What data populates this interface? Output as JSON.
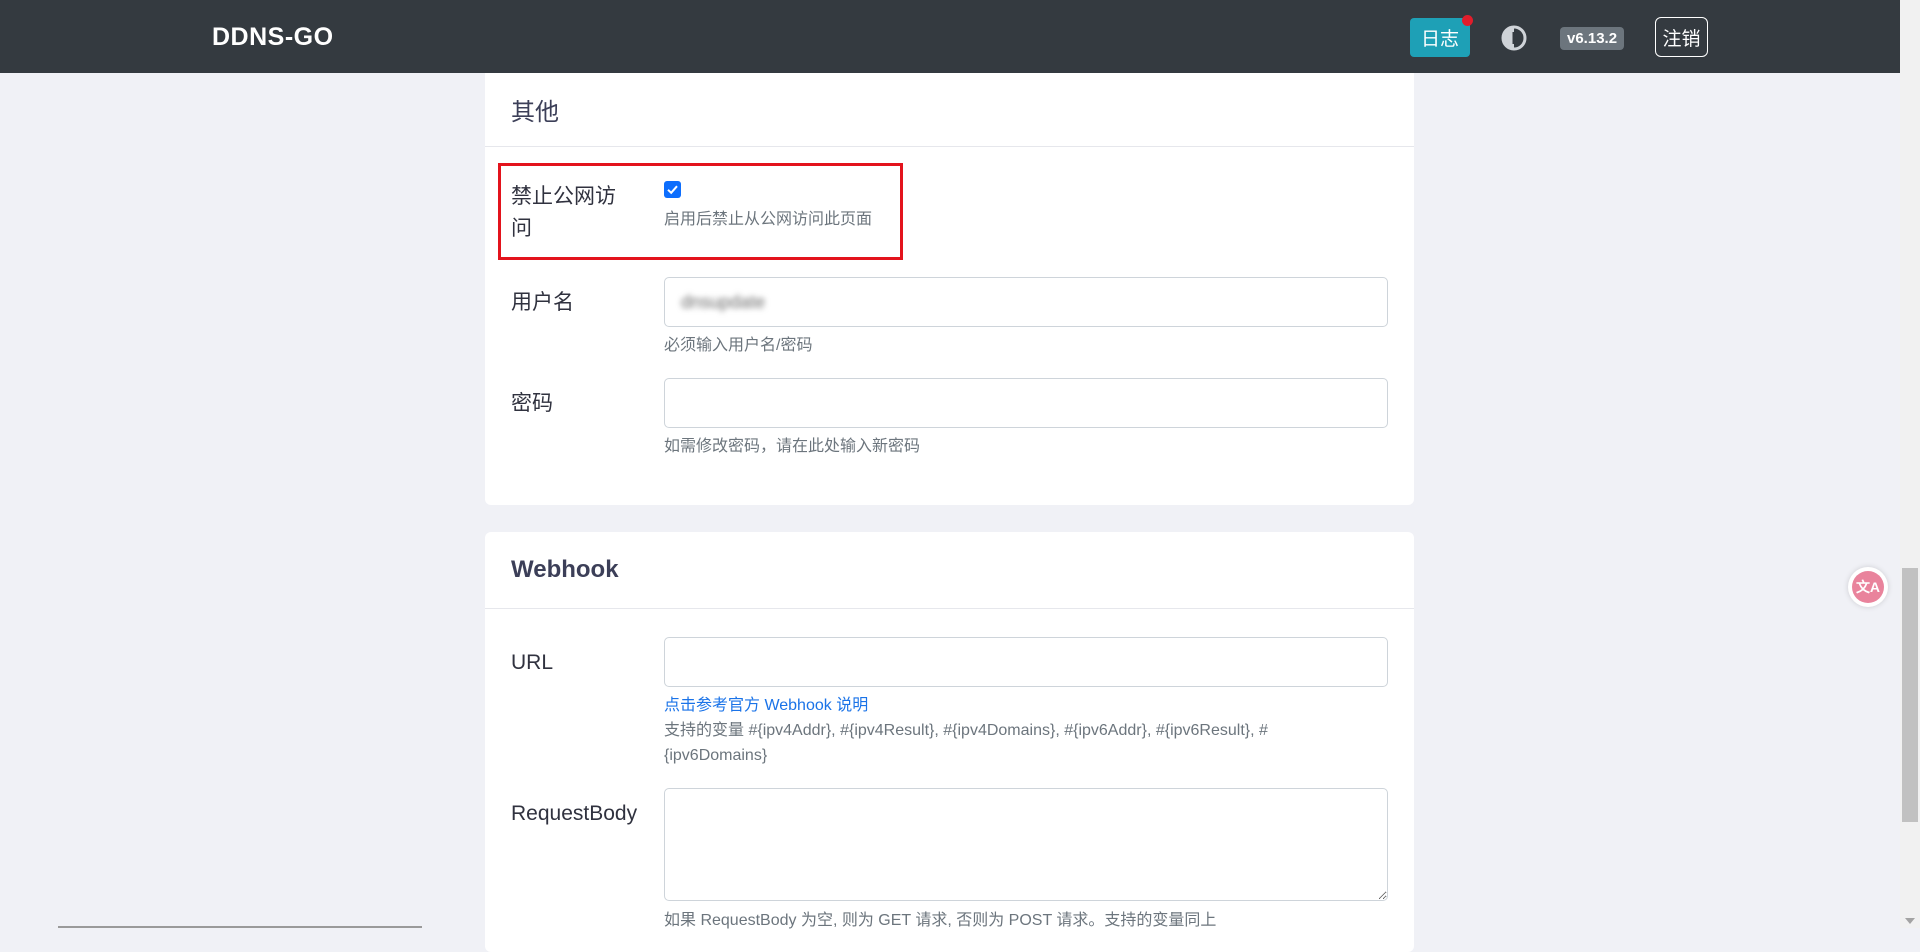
{
  "nav": {
    "brand": "DDNS-GO",
    "log_label": "日志",
    "version": "v6.13.2",
    "logout_label": "注销",
    "theme_icon": "theme-toggle-icon"
  },
  "colors": {
    "navbar": "#343a40",
    "log_button": "#1ea0b6",
    "notification_dot": "#e11d2b",
    "highlight": "#e3131c",
    "link": "#1a73e8",
    "checkbox": "#0d6efd"
  },
  "other": {
    "title": "其他",
    "disable_public": {
      "label_line1": "禁止公网访",
      "label_line2": "问",
      "checked": true,
      "help": "启用后禁止从公网访问此页面"
    },
    "username": {
      "label": "用户名",
      "value": "dnsupdate",
      "help": "必须输入用户名/密码"
    },
    "password": {
      "label": "密码",
      "value": "",
      "help": "如需修改密码，请在此处输入新密码"
    }
  },
  "webhook": {
    "title": "Webhook",
    "url": {
      "label": "URL",
      "value": "",
      "link": "点击参考官方 Webhook 说明",
      "help_line1": "支持的变量 #{ipv4Addr}, #{ipv4Result}, #{ipv4Domains}, #{ipv6Addr}, #{ipv6Result}, #",
      "help_line2": "{ipv6Domains}"
    },
    "request_body": {
      "label": "RequestBody",
      "value": "",
      "help": "如果 RequestBody 为空, 则为 GET 请求, 否则为 POST 请求。支持的变量同上"
    }
  },
  "floating": {
    "translate_icon": "translate-icon",
    "translate_text": "文A"
  }
}
